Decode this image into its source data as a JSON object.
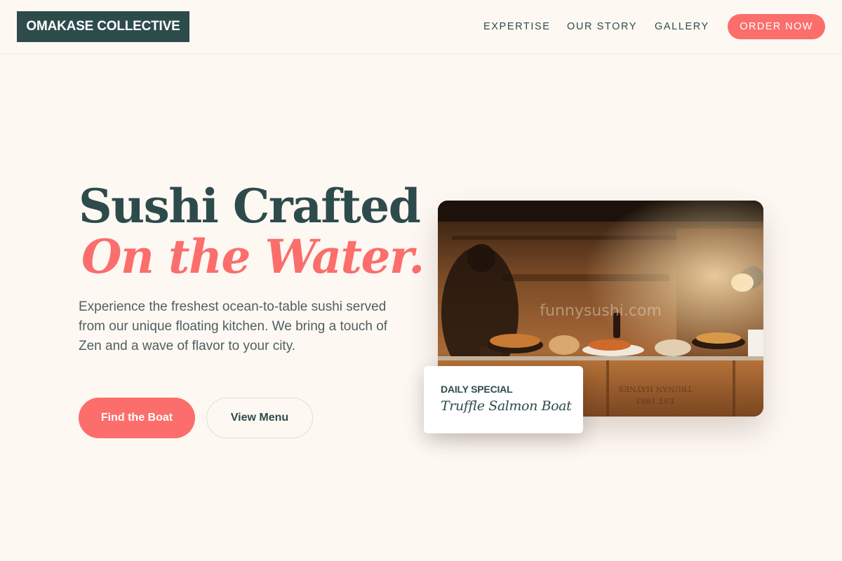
{
  "brand": {
    "name": "OMAKASE COLLECTIVE"
  },
  "nav": {
    "links": [
      "EXPERTISE",
      "OUR STORY",
      "GALLERY"
    ],
    "cta": "ORDER NOW"
  },
  "hero": {
    "title": "Sushi Crafted",
    "title_accent": "On the Water.",
    "description": "Experience the freshest ocean-to-table sushi served from our unique floating kitchen. We bring a touch of Zen and a wave of flavor to your city.",
    "primary_button": "Find the Boat",
    "secondary_button": "View Menu"
  },
  "photo": {
    "watermark": "funnysushi.com"
  },
  "special": {
    "label": "DAILY SPECIAL",
    "name": "Truffle Salmon Boat"
  },
  "colors": {
    "background": "#fef8f3",
    "primary": "#2e4b4c",
    "accent": "#fb6e6c"
  }
}
